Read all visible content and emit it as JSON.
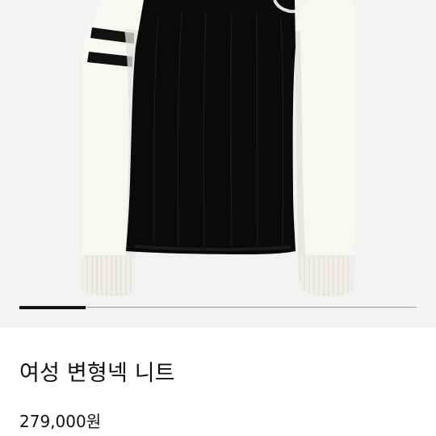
{
  "product": {
    "title": "여성 변형넥 니트",
    "price": "279,000원"
  },
  "image": {
    "background_color": "#f2f2f2",
    "body_color": "#0a0a0a",
    "sleeve_color": "#f8f7f1"
  },
  "carousel": {
    "track_color": "#9f9f9f",
    "indicator_color": "#111111"
  }
}
